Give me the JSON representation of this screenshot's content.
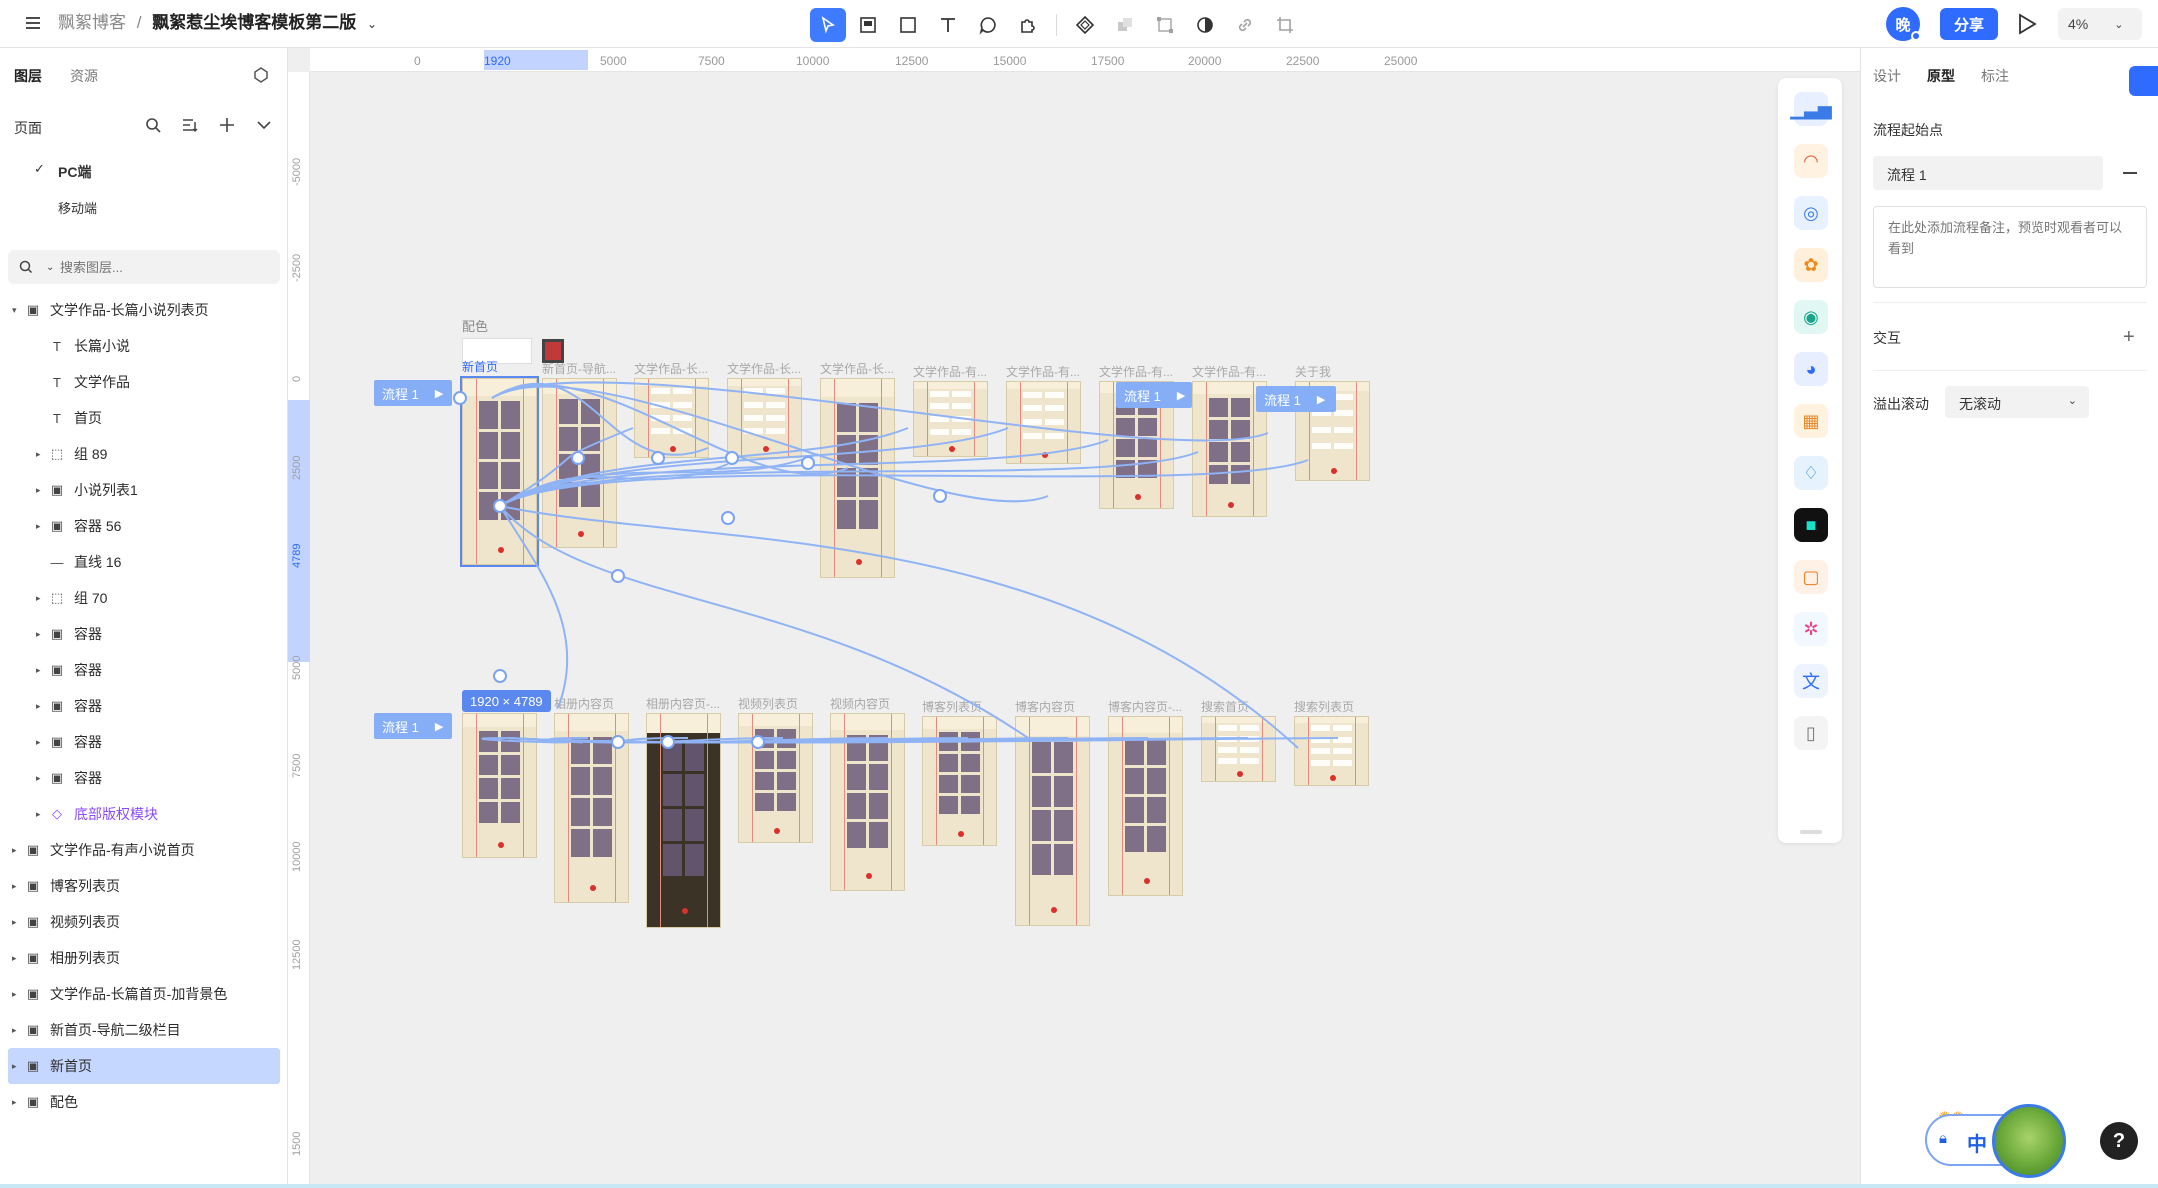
{
  "topbar": {
    "project": "飘絮博客",
    "separator": "/",
    "file_name": "飘絮惹尘埃博客模板第二版",
    "avatar_initial": "晚",
    "share_label": "分享",
    "zoom": "4%"
  },
  "left_panel": {
    "tabs": [
      "图层",
      "资源"
    ],
    "pages_label": "页面",
    "pages": [
      "PC端",
      "移动端"
    ],
    "search_placeholder": "搜索图层...",
    "layers": [
      {
        "label": "文学作品-长篇小说列表页",
        "type": "frame",
        "depth": 0,
        "expanded": true
      },
      {
        "label": "长篇小说",
        "type": "text",
        "depth": 1
      },
      {
        "label": "文学作品",
        "type": "text",
        "depth": 1
      },
      {
        "label": "首页",
        "type": "text",
        "depth": 1
      },
      {
        "label": "组 89",
        "type": "group",
        "depth": 1
      },
      {
        "label": "小说列表1",
        "type": "frame",
        "depth": 1
      },
      {
        "label": "容器 56",
        "type": "frame",
        "depth": 1
      },
      {
        "label": "直线 16",
        "type": "line",
        "depth": 1
      },
      {
        "label": "组 70",
        "type": "group",
        "depth": 1
      },
      {
        "label": "容器",
        "type": "frame",
        "depth": 1
      },
      {
        "label": "容器",
        "type": "frame",
        "depth": 1
      },
      {
        "label": "容器",
        "type": "frame",
        "depth": 1
      },
      {
        "label": "容器",
        "type": "frame",
        "depth": 1
      },
      {
        "label": "容器",
        "type": "frame",
        "depth": 1
      },
      {
        "label": "底部版权模块",
        "type": "component",
        "depth": 1
      },
      {
        "label": "文学作品-有声小说首页",
        "type": "frame",
        "depth": 0
      },
      {
        "label": "博客列表页",
        "type": "frame",
        "depth": 0
      },
      {
        "label": "视频列表页",
        "type": "frame",
        "depth": 0
      },
      {
        "label": "相册列表页",
        "type": "frame",
        "depth": 0
      },
      {
        "label": "文学作品-长篇首页-加背景色",
        "type": "frame",
        "depth": 0
      },
      {
        "label": "新首页-导航二级栏目",
        "type": "frame",
        "depth": 0
      },
      {
        "label": "新首页",
        "type": "frame",
        "depth": 0,
        "selected": true
      },
      {
        "label": "配色",
        "type": "frame",
        "depth": 0
      }
    ]
  },
  "canvas": {
    "h_ruler": [
      "0",
      "1920",
      "5000",
      "7500",
      "10000",
      "12500",
      "15000",
      "17500",
      "20000",
      "22500",
      "25000"
    ],
    "v_ruler": [
      "-5000",
      "-2500",
      "0",
      "2500",
      "4789",
      "5000",
      "7500",
      "10000",
      "12500",
      "1500"
    ],
    "palette_label": "配色",
    "selection_size": "1920 × 4789",
    "flow_tag": "流程 1",
    "row1_boards": [
      "新首页",
      "新首页-导航...",
      "文学作品-长...",
      "文学作品-长...",
      "文学作品-长...",
      "文学作品-有...",
      "文学作品-有...",
      "文学作品-有...",
      "文学作品-有...",
      "关于我"
    ],
    "row2_boards": [
      "相册列表页",
      "相册内容页",
      "相册内容页-...",
      "视频列表页",
      "视频内容页",
      "博客列表页",
      "博客内容页",
      "博客内容页-...",
      "搜索首页",
      "搜索列表页"
    ]
  },
  "plugins": [
    "chart-plugin-icon",
    "rainbow-plugin-icon",
    "globe-plugin-icon",
    "flower-plugin-icon",
    "frog-plugin-icon",
    "owl-plugin-icon",
    "puzzle-plugin-icon",
    "bulb-plugin-icon",
    "dark-square-plugin-icon",
    "layers-plugin-icon",
    "pinwheel-plugin-icon",
    "translate-plugin-icon",
    "book-plugin-icon"
  ],
  "right_panel": {
    "tabs": [
      "设计",
      "原型",
      "标注"
    ],
    "flow_start_label": "流程起始点",
    "flow_name": "流程 1",
    "note_placeholder": "在此处添加流程备注，预览时观看者可以看到",
    "interaction_label": "交互",
    "overflow_label": "溢出滚动",
    "overflow_value": "无滚动"
  },
  "widget": {
    "lang": "中",
    "help": "?"
  }
}
